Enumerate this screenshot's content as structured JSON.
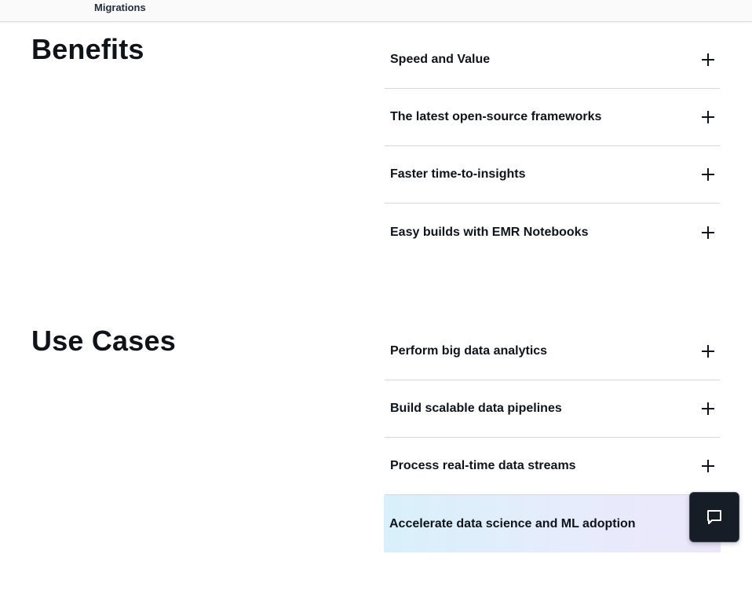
{
  "top_nav": {
    "link_label": "Migrations"
  },
  "benefits": {
    "title": "Benefits",
    "items": [
      {
        "label": "Speed and Value"
      },
      {
        "label": "The latest open-source frameworks"
      },
      {
        "label": "Faster time-to-insights"
      },
      {
        "label": "Easy builds with EMR Notebooks"
      }
    ]
  },
  "use_cases": {
    "title": "Use Cases",
    "items": [
      {
        "label": "Perform big data analytics"
      },
      {
        "label": "Build scalable data pipelines"
      },
      {
        "label": "Process real-time data streams"
      },
      {
        "label": "Accelerate data science and ML adoption"
      }
    ]
  },
  "chat": {
    "icon": "chat-bubble-icon"
  },
  "colors": {
    "text": "#0f141a",
    "divider": "#d5d9d9",
    "chat_bg": "#161d26",
    "highlight_start": "#d8f0fb",
    "highlight_end": "#ece6fb"
  }
}
